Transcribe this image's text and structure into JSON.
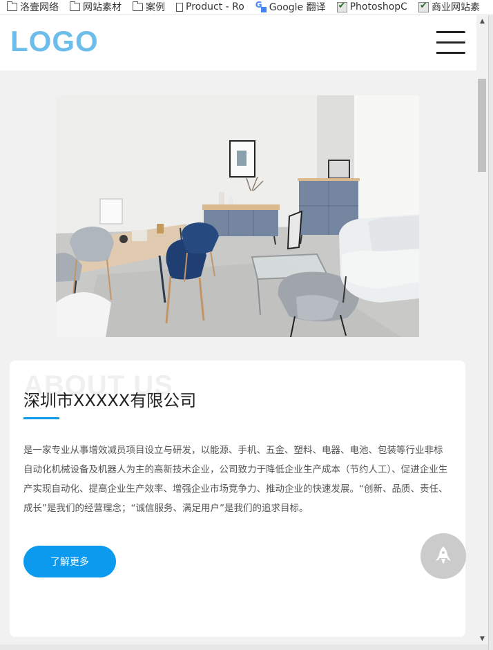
{
  "bookmarks": [
    {
      "label": "洛壹网络",
      "icon": "folder-icon"
    },
    {
      "label": "网站素材",
      "icon": "folder-icon"
    },
    {
      "label": "案例",
      "icon": "folder-icon"
    },
    {
      "label": "Product - Ro",
      "icon": "page-icon"
    },
    {
      "label": "Google 翻译",
      "icon": "google-translate-icon"
    },
    {
      "label": "PhotoshopC",
      "icon": "vector-icon"
    },
    {
      "label": "商业网站素",
      "icon": "vector-icon"
    }
  ],
  "header": {
    "logo": "LOGO",
    "menu_icon": "hamburger-menu-icon"
  },
  "hero": {
    "image": "living-room-interior-photo"
  },
  "about": {
    "watermark": "ABOUT US",
    "title": "深圳市XXXXX有限公司",
    "description": "是一家专业从事增效减员项目设立与研发，以能源、手机、五金、塑料、电器、电池、包装等行业非标自动化机械设备及机器人为主的高新技术企业，公司致力于降低企业生产成本（节约人工）、促进企业生产实现自动化、提高企业生产效率、增强企业市场竞争力、推动企业的快速发展。“创新、品质、责任、成长”是我们的经营理念；“诚信服务、满足用户”是我们的追求目标。",
    "more_button": "了解更多"
  },
  "floating": {
    "icon": "rocket-icon"
  },
  "colors": {
    "accent": "#0c9aee",
    "logo": "#6dbdea",
    "page_bg": "#f1f1f1"
  }
}
